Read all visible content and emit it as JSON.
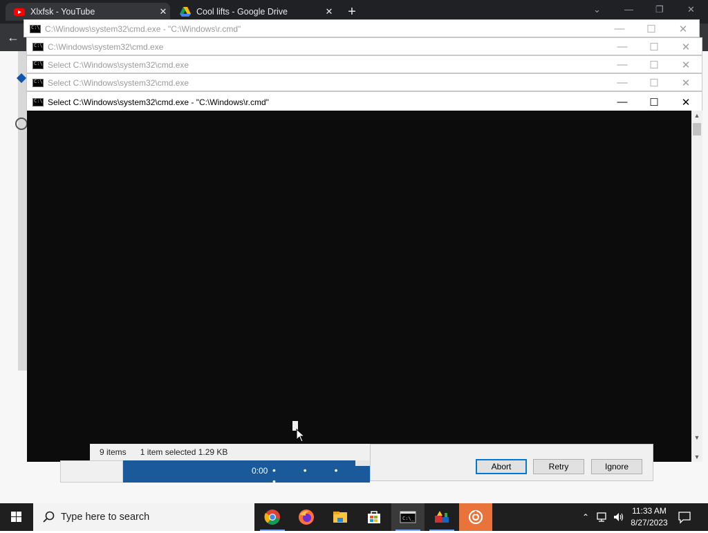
{
  "browser": {
    "tabs": [
      {
        "title": "Xlxfsk - YouTube",
        "icon": "youtube-icon"
      },
      {
        "title": "Cool lifts - Google Drive",
        "icon": "google-drive-icon"
      }
    ],
    "new_tab": "+",
    "close_glyph": "✕"
  },
  "cmd_windows": [
    {
      "title": "C:\\Windows\\system32\\cmd.exe - \"C:\\Windows\\r.cmd\"",
      "state": "inactive"
    },
    {
      "title": "C:\\Windows\\system32\\cmd.exe",
      "state": "inactive"
    },
    {
      "title": "Select C:\\Windows\\system32\\cmd.exe",
      "state": "inactive"
    },
    {
      "title": "Select C:\\Windows\\system32\\cmd.exe",
      "state": "inactive"
    },
    {
      "title": "Select C:\\Windows\\system32\\cmd.exe - \"C:\\Windows\\r.cmd\"",
      "state": "active"
    }
  ],
  "window_buttons": {
    "minimize": "—",
    "maximize": "☐",
    "close": "✕"
  },
  "explorer_status": {
    "items": "9 items",
    "selected": "1 item selected  1.29 KB"
  },
  "player": {
    "time": "0:00",
    "dots": "• • • •"
  },
  "message_box": {
    "buttons": [
      "Abort",
      "Retry",
      "Ignore"
    ],
    "default_button": "Abort"
  },
  "taskbar": {
    "search_placeholder": "Type here to search",
    "apps": [
      "chrome-icon",
      "firefox-icon",
      "file-explorer-icon",
      "microsoft-store-icon",
      "cmd-icon",
      "package-app-icon",
      "media-app-icon"
    ],
    "clock_time": "11:33 AM",
    "clock_date": "8/27/2023"
  },
  "colors": {
    "cmd_background": "#0c0c0c",
    "taskbar": "#1f1f1f",
    "accent": "#0078d7"
  }
}
